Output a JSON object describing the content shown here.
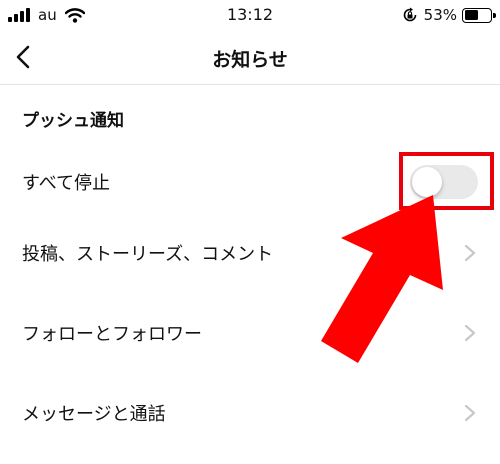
{
  "status_bar": {
    "carrier": "au",
    "time": "13:12",
    "battery_percent": "53%",
    "battery_level": 0.53,
    "icons": [
      "signal-icon",
      "wifi-icon",
      "orientation-lock-icon",
      "battery-icon"
    ]
  },
  "nav": {
    "title": "お知らせ",
    "back_icon": "chevron-left-icon"
  },
  "push_section": {
    "header": "プッシュ通知",
    "pause_all": {
      "label": "すべて停止",
      "toggle_on": false
    },
    "items": [
      {
        "label": "投稿、ストーリーズ、コメント",
        "icon": "chevron-right-icon"
      },
      {
        "label": "フォローとフォロワー",
        "icon": "chevron-right-icon"
      },
      {
        "label": "メッセージと通話",
        "icon": "chevron-right-icon"
      }
    ]
  },
  "annotation": {
    "highlight_color": "#e8000b",
    "arrow_color": "#ff0000"
  },
  "colors": {
    "background": "#ffffff",
    "text": "#111111",
    "divider": "#e3e3e3",
    "toggle_off": "#e9e9ea",
    "chevron": "#c7c7cc"
  }
}
